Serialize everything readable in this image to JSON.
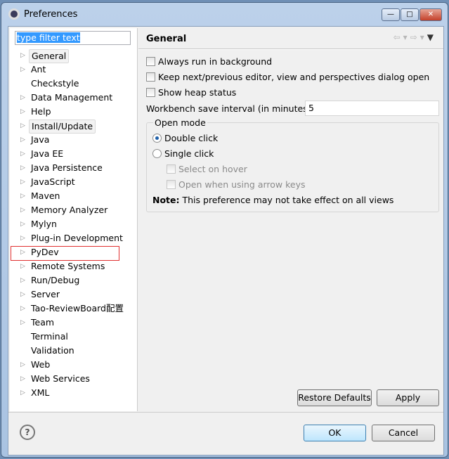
{
  "window": {
    "title": "Preferences",
    "minimize": "—",
    "maximize": "□",
    "close": "✕"
  },
  "filter": {
    "value": "type filter text"
  },
  "tree": [
    {
      "label": "General",
      "expandable": true,
      "selected": true
    },
    {
      "label": "Ant",
      "expandable": true
    },
    {
      "label": "Checkstyle",
      "expandable": false
    },
    {
      "label": "Data Management",
      "expandable": true
    },
    {
      "label": "Help",
      "expandable": true
    },
    {
      "label": "Install/Update",
      "expandable": true,
      "hover": true
    },
    {
      "label": "Java",
      "expandable": true
    },
    {
      "label": "Java EE",
      "expandable": true
    },
    {
      "label": "Java Persistence",
      "expandable": true
    },
    {
      "label": "JavaScript",
      "expandable": true
    },
    {
      "label": "Maven",
      "expandable": true
    },
    {
      "label": "Memory Analyzer",
      "expandable": true
    },
    {
      "label": "Mylyn",
      "expandable": true
    },
    {
      "label": "Plug-in Development",
      "expandable": true
    },
    {
      "label": "PyDev",
      "expandable": true,
      "highlighted": true
    },
    {
      "label": "Remote Systems",
      "expandable": true
    },
    {
      "label": "Run/Debug",
      "expandable": true
    },
    {
      "label": "Server",
      "expandable": true
    },
    {
      "label": "Tao-ReviewBoard配置",
      "expandable": true
    },
    {
      "label": "Team",
      "expandable": true
    },
    {
      "label": "Terminal",
      "expandable": false
    },
    {
      "label": "Validation",
      "expandable": false
    },
    {
      "label": "Web",
      "expandable": true
    },
    {
      "label": "Web Services",
      "expandable": true
    },
    {
      "label": "XML",
      "expandable": true
    }
  ],
  "page": {
    "title": "General",
    "options": [
      {
        "label": "Always run in background",
        "checked": false
      },
      {
        "label": "Keep next/previous editor, view and perspectives dialog open",
        "checked": false
      },
      {
        "label": "Show heap status",
        "checked": false
      }
    ],
    "save_interval_label": "Workbench save interval (in minutes):",
    "save_interval_value": "5",
    "open_mode": {
      "label": "Open mode",
      "double": "Double click",
      "single": "Single click",
      "selected": "Double click",
      "select_hover": "Select on hover",
      "arrow_keys": "Open when using arrow keys",
      "note_bold": "Note:",
      "note": " This preference may not take effect on all views"
    }
  },
  "buttons": {
    "restore": "Restore Defaults",
    "apply": "Apply",
    "ok": "OK",
    "cancel": "Cancel",
    "help": "?"
  }
}
